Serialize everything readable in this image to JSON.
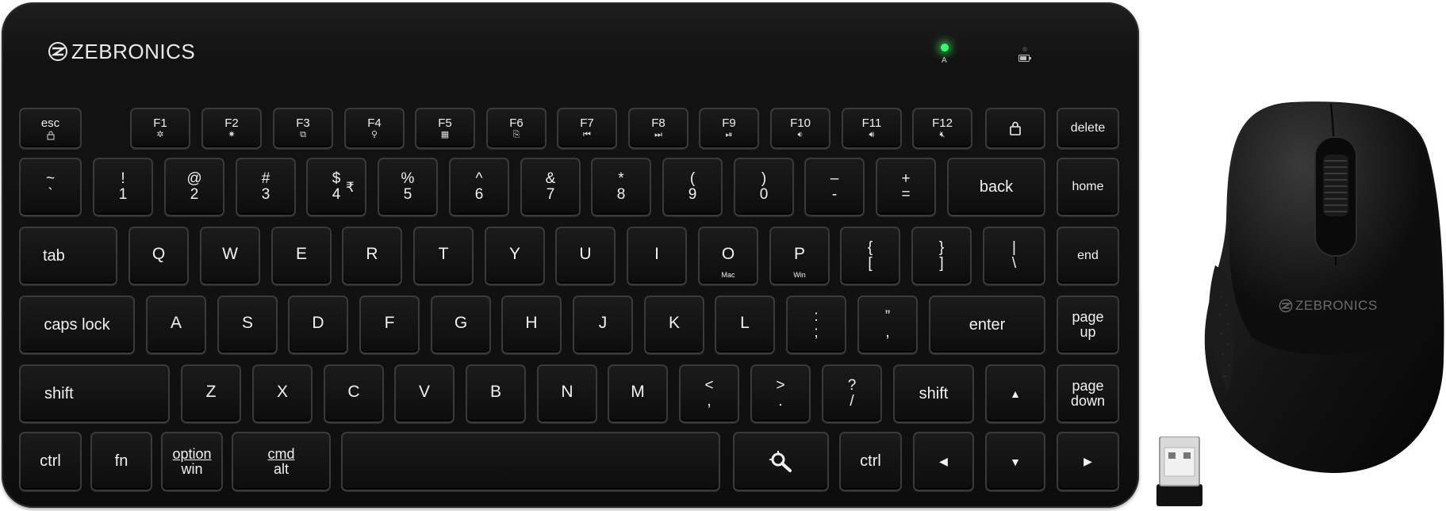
{
  "brand": "ZEBRONICS",
  "mouse_brand": "ZEBRONICS",
  "indicator_label": "A",
  "row_fn": [
    "esc",
    "F1",
    "F2",
    "F3",
    "F4",
    "F5",
    "F6",
    "F7",
    "F8",
    "F9",
    "F10",
    "F11",
    "F12",
    "delete"
  ],
  "row_num": {
    "tilde": [
      "~",
      "`"
    ],
    "k1": [
      "!",
      "1"
    ],
    "k2": [
      "@",
      "2"
    ],
    "k3": [
      "#",
      "3"
    ],
    "k4": [
      "$",
      "4"
    ],
    "rupee": "₹",
    "k5": [
      "%",
      "5"
    ],
    "k6": [
      "^",
      "6"
    ],
    "k7": [
      "&",
      "7"
    ],
    "k8": [
      "*",
      "8"
    ],
    "k9": [
      "(",
      "9"
    ],
    "k0": [
      ")",
      "0"
    ],
    "minus": [
      "–",
      "-"
    ],
    "plus": [
      "+",
      "="
    ],
    "back": "back",
    "home": "home"
  },
  "row_q": {
    "tab": "tab",
    "letters": [
      "Q",
      "W",
      "E",
      "R",
      "T",
      "Y",
      "U",
      "I",
      "O",
      "P"
    ],
    "o_sub": "Mac",
    "p_sub": "Win",
    "lbrace": [
      "{",
      "["
    ],
    "rbrace": [
      "}",
      "]"
    ],
    "pipe": [
      "|",
      "\\"
    ],
    "end": "end"
  },
  "row_a": {
    "caps": "caps lock",
    "letters": [
      "A",
      "S",
      "D",
      "F",
      "G",
      "H",
      "J",
      "K",
      "L"
    ],
    "semi": [
      ":",
      ";"
    ],
    "quote": [
      "”",
      ","
    ],
    "enter": "enter",
    "pageup": [
      "page",
      "up"
    ]
  },
  "row_z": {
    "shift": "shift",
    "letters": [
      "Z",
      "X",
      "C",
      "V",
      "B",
      "N",
      "M"
    ],
    "lt": [
      "<",
      ","
    ],
    "gt": [
      ">",
      "."
    ],
    "qm": [
      "?",
      "/"
    ],
    "shift_r": "shift",
    "pagedown": [
      "page",
      "down"
    ]
  },
  "row_bottom": {
    "ctrl": "ctrl",
    "fn": "fn",
    "option": [
      "option",
      "win"
    ],
    "cmd": [
      "cmd",
      "alt"
    ],
    "ctrl_r": "ctrl"
  }
}
